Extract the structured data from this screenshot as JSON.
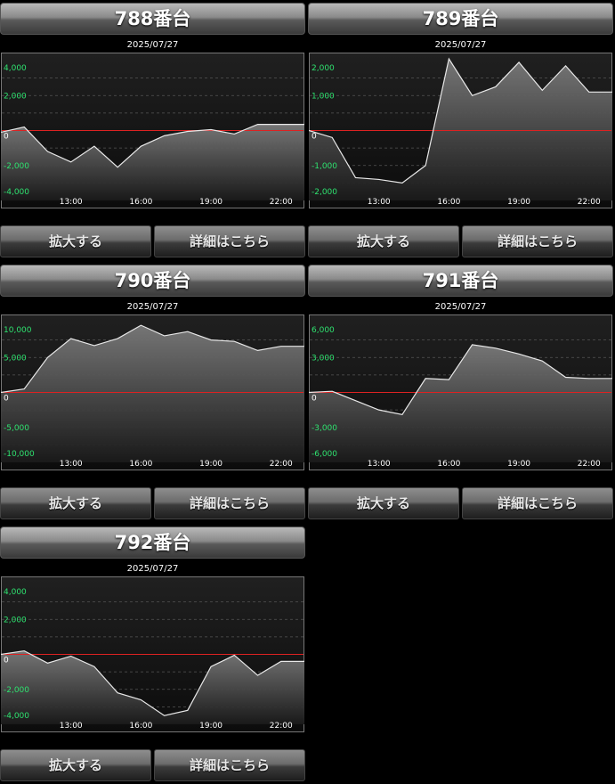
{
  "panels": [
    {
      "title": "788番台",
      "date": "2025/07/27",
      "zoom_label": "拡大する",
      "detail_label": "詳細はこちら",
      "chart_data": {
        "type": "area",
        "x": [
          "10:00",
          "11:00",
          "12:00",
          "13:00",
          "14:00",
          "15:00",
          "16:00",
          "17:00",
          "18:00",
          "19:00",
          "20:00",
          "21:00",
          "22:00",
          "23:00"
        ],
        "values": [
          -100,
          200,
          -1200,
          -1800,
          -900,
          -2100,
          -900,
          -300,
          -50,
          50,
          -200,
          350,
          350,
          350
        ],
        "ylim": [
          -4000,
          4000
        ],
        "yticks": [
          4000,
          2000,
          0,
          -2000,
          -4000
        ],
        "ytick_labels": [
          "4,000",
          "2,000",
          "0",
          "-2,000",
          "-4,000"
        ],
        "xticks": [
          "13:00",
          "16:00",
          "19:00",
          "22:00"
        ]
      }
    },
    {
      "title": "789番台",
      "date": "2025/07/27",
      "zoom_label": "拡大する",
      "detail_label": "詳細はこちら",
      "chart_data": {
        "type": "area",
        "x": [
          "10:00",
          "11:00",
          "12:00",
          "13:00",
          "14:00",
          "15:00",
          "16:00",
          "17:00",
          "18:00",
          "19:00",
          "20:00",
          "21:00",
          "22:00",
          "23:00"
        ],
        "values": [
          0,
          -200,
          -1350,
          -1400,
          -1500,
          -1000,
          2050,
          1000,
          1250,
          1950,
          1150,
          1850,
          1100,
          1100
        ],
        "ylim": [
          -2000,
          2000
        ],
        "yticks": [
          2000,
          1000,
          0,
          -1000,
          -2000
        ],
        "ytick_labels": [
          "2,000",
          "1,000",
          "0",
          "-1,000",
          "-2,000"
        ],
        "xticks": [
          "13:00",
          "16:00",
          "19:00",
          "22:00"
        ]
      }
    },
    {
      "title": "790番台",
      "date": "2025/07/27",
      "zoom_label": "拡大する",
      "detail_label": "詳細はこちら",
      "chart_data": {
        "type": "area",
        "x": [
          "10:00",
          "11:00",
          "12:00",
          "13:00",
          "14:00",
          "15:00",
          "16:00",
          "17:00",
          "18:00",
          "19:00",
          "20:00",
          "21:00",
          "22:00",
          "23:00"
        ],
        "values": [
          0,
          500,
          5000,
          7700,
          6700,
          7700,
          9600,
          8100,
          8700,
          7500,
          7300,
          6000,
          6600,
          6600
        ],
        "ylim": [
          -10000,
          10000
        ],
        "yticks": [
          10000,
          5000,
          0,
          -5000,
          -10000
        ],
        "ytick_labels": [
          "10,000",
          "5,000",
          "0",
          "-5,000",
          "-10,000"
        ],
        "xticks": [
          "13:00",
          "16:00",
          "19:00",
          "22:00"
        ]
      }
    },
    {
      "title": "791番台",
      "date": "2025/07/27",
      "zoom_label": "拡大する",
      "detail_label": "詳細はこちら",
      "chart_data": {
        "type": "area",
        "x": [
          "10:00",
          "11:00",
          "12:00",
          "13:00",
          "14:00",
          "15:00",
          "16:00",
          "17:00",
          "18:00",
          "19:00",
          "20:00",
          "21:00",
          "22:00",
          "23:00"
        ],
        "values": [
          0,
          100,
          -700,
          -1500,
          -1900,
          1200,
          1100,
          4100,
          3800,
          3300,
          2700,
          1300,
          1200,
          1200
        ],
        "ylim": [
          -6000,
          6000
        ],
        "yticks": [
          6000,
          3000,
          0,
          -3000,
          -6000
        ],
        "ytick_labels": [
          "6,000",
          "3,000",
          "0",
          "-3,000",
          "-6,000"
        ],
        "xticks": [
          "13:00",
          "16:00",
          "19:00",
          "22:00"
        ]
      }
    },
    {
      "title": "792番台",
      "date": "2025/07/27",
      "zoom_label": "拡大する",
      "detail_label": "詳細はこちら",
      "chart_data": {
        "type": "area",
        "x": [
          "10:00",
          "11:00",
          "12:00",
          "13:00",
          "14:00",
          "15:00",
          "16:00",
          "17:00",
          "18:00",
          "19:00",
          "20:00",
          "21:00",
          "22:00",
          "23:00"
        ],
        "values": [
          0,
          200,
          -500,
          -100,
          -700,
          -2200,
          -2600,
          -3500,
          -3200,
          -700,
          -50,
          -1200,
          -400,
          -400
        ],
        "ylim": [
          -4000,
          4000
        ],
        "yticks": [
          4000,
          2000,
          0,
          -2000,
          -4000
        ],
        "ytick_labels": [
          "4,000",
          "2,000",
          "0",
          "-2,000",
          "-4,000"
        ],
        "xticks": [
          "13:00",
          "16:00",
          "19:00",
          "22:00"
        ]
      }
    }
  ]
}
